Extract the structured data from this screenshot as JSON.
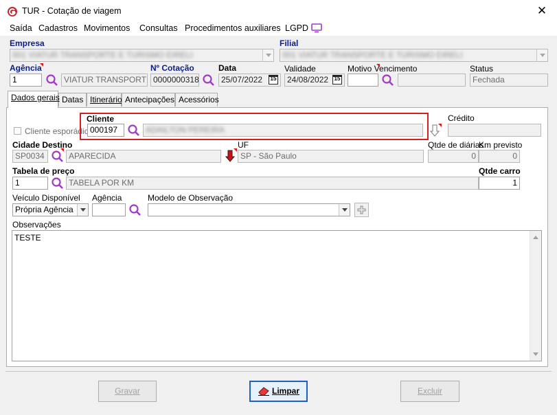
{
  "window": {
    "title": "TUR - Cotação de viagem",
    "close_glyph": "✕"
  },
  "menu": [
    "Saída",
    "Cadastros",
    "Movimentos",
    "Consultas",
    "Procedimentos auxiliares",
    "LGPD"
  ],
  "header": {
    "empresa_label": "Empresa",
    "empresa_value": "001 VIATUR TRANSPORTE E TURISMO EIRELI",
    "filial_label": "Filial",
    "filial_value": "001 VIATUR TRANSPORTE E TURISMO EIRELI",
    "agencia_label": "Agência",
    "agencia_code": "1",
    "agencia_name": "VIATUR TRANSPORTE E",
    "cotacao_label": "Nº Cotação",
    "cotacao_value": "0000000318",
    "data_label": "Data",
    "data_value": "25/07/2022",
    "validade_label": "Validade",
    "validade_value": "24/08/2022",
    "motivo_label": "Motivo Vencimento",
    "motivo_code": "",
    "motivo_desc": "",
    "status_label": "Status",
    "status_value": "Fechada",
    "calendar_glyph": "15"
  },
  "tabs": [
    "Dados gerais",
    "Datas",
    "Itinerário",
    "Antecipações",
    "Acessórios"
  ],
  "form": {
    "cliente_esporadico_label": "Cliente esporádico",
    "cliente_label": "Cliente",
    "cliente_code": "000197",
    "cliente_name": "ADAILTON PEREIRA",
    "credito_label": "Crédito",
    "credito_value": "",
    "cidade_label": "Cidade Destino",
    "cidade_code": "SP0034",
    "cidade_name": "APARECIDA",
    "uf_label": "UF",
    "uf_value": "SP - São Paulo",
    "qtde_diarias_label": "Qtde de diárias",
    "qtde_diarias_value": "0",
    "km_label": "Km previsto",
    "km_value": "0",
    "tabela_label": "Tabela de preço",
    "tabela_code": "1",
    "tabela_name": "TABELA POR KM",
    "qtde_carro_label": "Qtde carro",
    "qtde_carro_value": "1",
    "veiculo_label": "Veículo Disponível",
    "veiculo_value": "Própria Agência",
    "agencia2_label": "Agência",
    "agencia2_value": "",
    "modelo_label": "Modelo de Observação",
    "modelo_value": "",
    "obs_label": "Observações",
    "obs_value": "TESTE"
  },
  "buttons": {
    "gravar": "Gravar",
    "limpar": "Limpar",
    "excluir": "Excluir"
  },
  "colors": {
    "accent": "#a338c8",
    "highlight": "#d62020",
    "label_blue": "#0b1d8c"
  }
}
